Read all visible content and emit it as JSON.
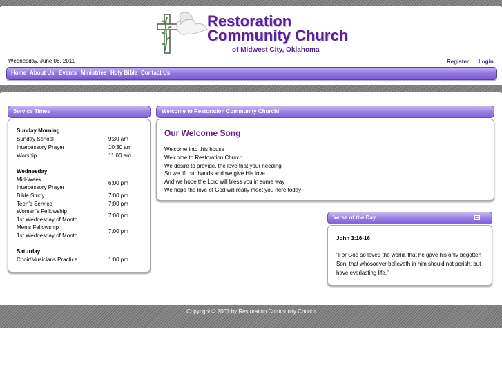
{
  "header": {
    "logo_title_line1": "Restoration",
    "logo_title_line2": "Community Church",
    "logo_subtitle": "of Midwest City, Oklahoma",
    "date": "Wednesday, June 08, 2011",
    "register_label": "Register",
    "login_label": "Login"
  },
  "nav": {
    "items": [
      {
        "label": "Home"
      },
      {
        "label": "About Us"
      },
      {
        "label": "Events"
      },
      {
        "label": "Ministries"
      },
      {
        "label": "Holy Bible"
      },
      {
        "label": "Contact Us"
      }
    ]
  },
  "service_times": {
    "title": "Service Times",
    "groups": [
      {
        "name": "Sunday Morning",
        "rows": [
          {
            "label": "Sunday School",
            "time": "9:30 am"
          },
          {
            "label": "Intercessory Prayer",
            "time": "10:30 am"
          },
          {
            "label": "Worship",
            "time": "11:00 am"
          }
        ]
      },
      {
        "name": "Wednesday",
        "rows": [
          {
            "label": "Mid-Week",
            "label2": "Intercessory Prayer",
            "time": "6:00 pm"
          },
          {
            "label": "Bible Study",
            "time": "7:00 pm"
          },
          {
            "label": "Teen's Service",
            "time": "7:00 pm"
          },
          {
            "label": "Women's Fellowship",
            "label2": "1st Wednesday of Month",
            "time": "7:00 pm"
          },
          {
            "label": "Men's Fellowship",
            "label2": "1st Wednesday of Month",
            "time": "7:00 pm"
          }
        ]
      },
      {
        "name": "Saturday",
        "rows": [
          {
            "label": "Choir/Musicians Practice",
            "time": "1:00 pm"
          }
        ]
      }
    ]
  },
  "welcome": {
    "title": "Welcome to Restoration Community Church!",
    "heading": "Our Welcome Song",
    "lines": [
      "Welcome into this house",
      "Welcome to Restoration Church",
      "We desire to provide, the love that your needing",
      "So we lift our hands and we give His love",
      "And we hope the Lord will bless you in some way",
      "We hope the love of God will really meet you here today"
    ]
  },
  "verse": {
    "title": "Verse of the Day",
    "reference": "John 3:16-16",
    "text": "\"For God so loved the world, that he gave his only begotten Son, that whosoever believeth in him should not perish, but have everlasting life.\""
  },
  "footer": {
    "copyright": "Copyright © 2007 by Restoration Community Church"
  },
  "icons": {
    "logo": "cross-and-dove-icon",
    "verse_toggle": "collapse-icon"
  }
}
